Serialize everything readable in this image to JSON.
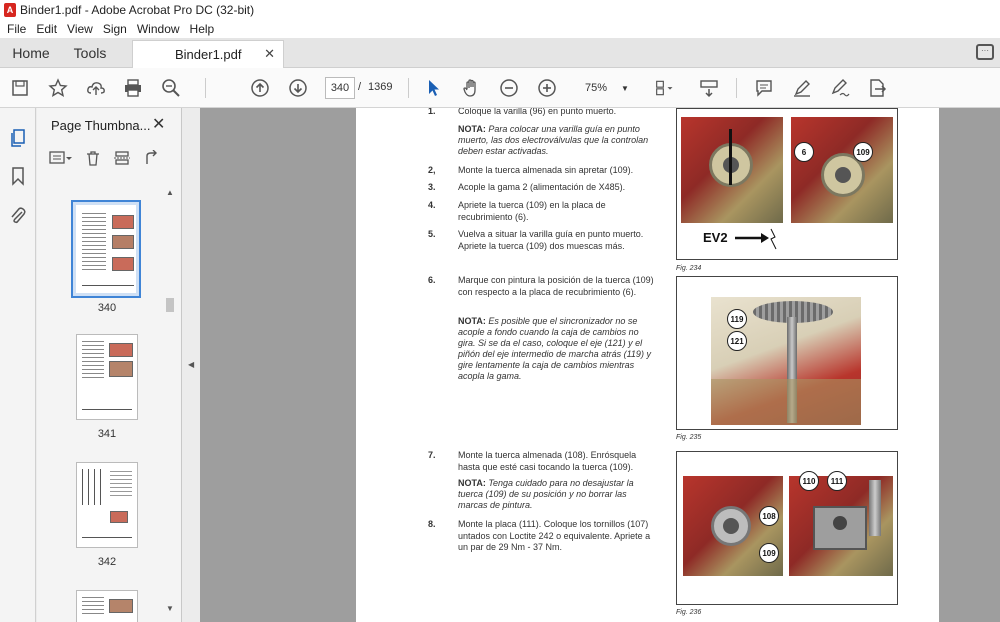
{
  "window": {
    "title": "Binder1.pdf - Adobe Acrobat Pro DC (32-bit)"
  },
  "menu": [
    "File",
    "Edit",
    "View",
    "Sign",
    "Window",
    "Help"
  ],
  "tabs": {
    "home": "Home",
    "tools": "Tools",
    "document": "Binder1.pdf"
  },
  "toolbar": {
    "page_current": "340",
    "page_separator": "/",
    "page_total": "1369",
    "zoom": "75%"
  },
  "panel": {
    "title": "Page Thumbna...",
    "thumbnails": [
      {
        "label": "340",
        "selected": true
      },
      {
        "label": "341",
        "selected": false
      },
      {
        "label": "342",
        "selected": false
      },
      {
        "label": "",
        "selected": false
      }
    ]
  },
  "page": {
    "steps": [
      {
        "num": "1.",
        "text": "Coloque la varilla (96) en punto muerto."
      },
      {
        "num": "2,",
        "text": "Monte la tuerca almenada sin apretar (109)."
      },
      {
        "num": "3.",
        "text": "Acople la gama 2 (alimentación de X485)."
      },
      {
        "num": "4.",
        "text": "Apriete la tuerca (109) en la placa de recubrimiento (6)."
      },
      {
        "num": "5.",
        "text": "Vuelva a situar la varilla guía en punto muerto. Apriete la tuerca (109) dos muescas más."
      },
      {
        "num": "6.",
        "text": "Marque con pintura la posición de la tuerca (109) con respecto a la placa de recubrimiento (6)."
      },
      {
        "num": "7.",
        "text": "Monte la tuerca almenada (108). Enrósquela hasta que esté casi tocando la tuerca (109)."
      },
      {
        "num": "8.",
        "text": "Monte la placa (111). Coloque los tornillos (107) untados con Loctite 242 o equivalente. Apriete a un par de 29 Nm - 37 Nm."
      }
    ],
    "notes": [
      {
        "label": "NOTA:",
        "text": "Para colocar una varilla guía en punto muerto, las dos electroválvulas que la controlan deben estar activadas."
      },
      {
        "label": "NOTA:",
        "text": "Es posible que el sincronizador no se acople a fondo cuando la caja de cambios no gira. Si se da el caso, coloque el eje (121) y el piñón del eje intermedio de marcha atrás (119) y gire lentamente la caja de cambios mientras acopla la gama."
      },
      {
        "label": "NOTA:",
        "text": "Tenga cuidado para no desajustar la tuerca (109) de su posición y no borrar las marcas de pintura."
      }
    ],
    "figures": [
      {
        "caption": "Fig. 234",
        "callouts": [
          "6",
          "109"
        ],
        "label": "EV2"
      },
      {
        "caption": "Fig. 235",
        "callouts": [
          "119",
          "121"
        ]
      },
      {
        "caption": "Fig. 236",
        "callouts": [
          "110",
          "111",
          "108",
          "109"
        ]
      }
    ]
  }
}
